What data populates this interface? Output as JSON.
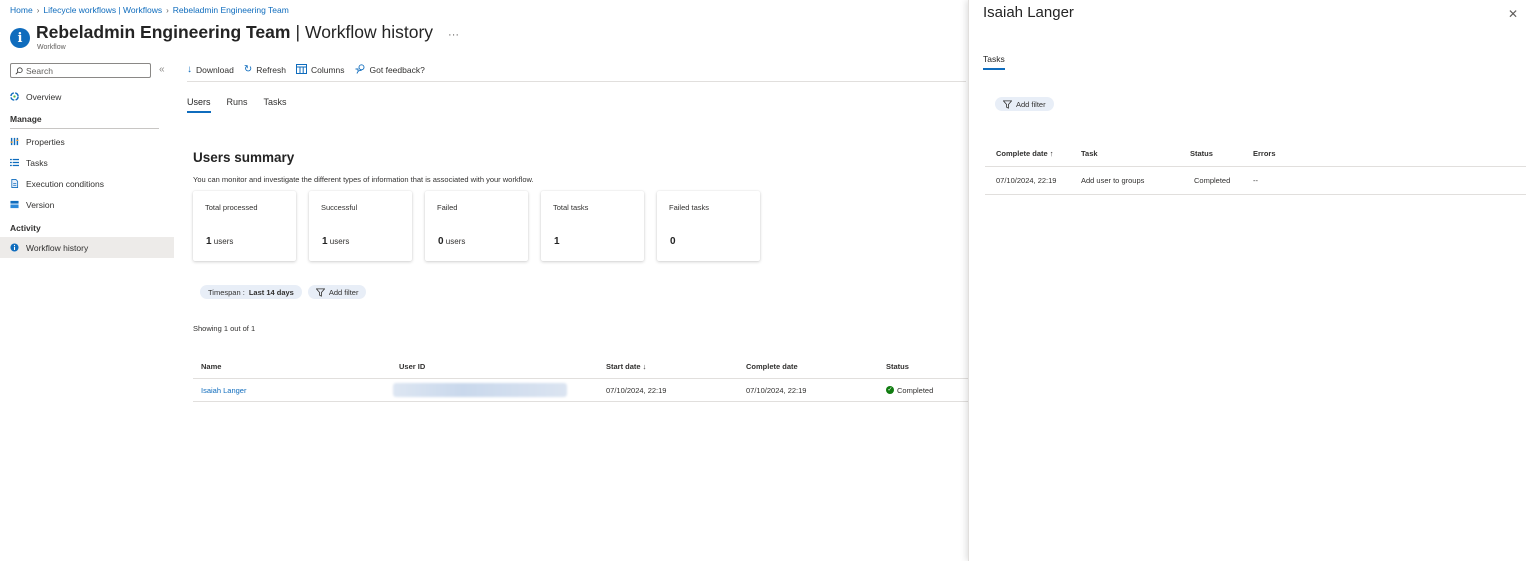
{
  "breadcrumb": [
    "Home",
    "Lifecycle workflows | Workflows",
    "Rebeladmin Engineering Team"
  ],
  "header": {
    "title": "Rebeladmin Engineering Team",
    "separator": "|",
    "subtitle": "Workflow history",
    "more": "···",
    "type": "Workflow"
  },
  "sidebar": {
    "search_placeholder": "Search",
    "collapse": "«",
    "overview": "Overview",
    "manage_heading": "Manage",
    "manage_items": [
      "Properties",
      "Tasks",
      "Execution conditions",
      "Version"
    ],
    "activity_heading": "Activity",
    "activity_items": [
      "Workflow history"
    ]
  },
  "toolbar": {
    "download": "Download",
    "refresh": "Refresh",
    "columns": "Columns",
    "feedback": "Got feedback?"
  },
  "tabs": [
    "Users",
    "Runs",
    "Tasks"
  ],
  "summary": {
    "title": "Users summary",
    "description": "You can monitor and investigate the different types of information that is associated with your workflow.",
    "cards": [
      {
        "label": "Total processed",
        "value": "1",
        "unit": "users"
      },
      {
        "label": "Successful",
        "value": "1",
        "unit": "users"
      },
      {
        "label": "Failed",
        "value": "0",
        "unit": "users"
      },
      {
        "label": "Total tasks",
        "value": "1",
        "unit": ""
      },
      {
        "label": "Failed tasks",
        "value": "0",
        "unit": ""
      }
    ]
  },
  "filters": {
    "timespan_label": "Timespan : ",
    "timespan_value": "Last 14 days",
    "add_filter": "Add filter"
  },
  "showing": "Showing 1 out of 1",
  "users_table": {
    "columns": [
      "Name",
      "User ID",
      "Start date ↓",
      "Complete date",
      "Status"
    ],
    "rows": [
      {
        "name": "Isaiah Langer",
        "user_id": "",
        "start": "07/10/2024, 22:19",
        "complete": "07/10/2024, 22:19",
        "status": "Completed"
      }
    ]
  },
  "panel": {
    "title": "Isaiah Langer",
    "close": "✕",
    "tab": "Tasks",
    "add_filter": "Add filter",
    "columns": [
      "Complete date ↑",
      "Task",
      "Status",
      "Errors"
    ],
    "rows": [
      {
        "complete": "07/10/2024, 22:19",
        "task": "Add user to groups",
        "status": "Completed",
        "errors": "--"
      }
    ]
  },
  "colors": {
    "accent": "#0f6cbd",
    "success": "#107c10"
  }
}
